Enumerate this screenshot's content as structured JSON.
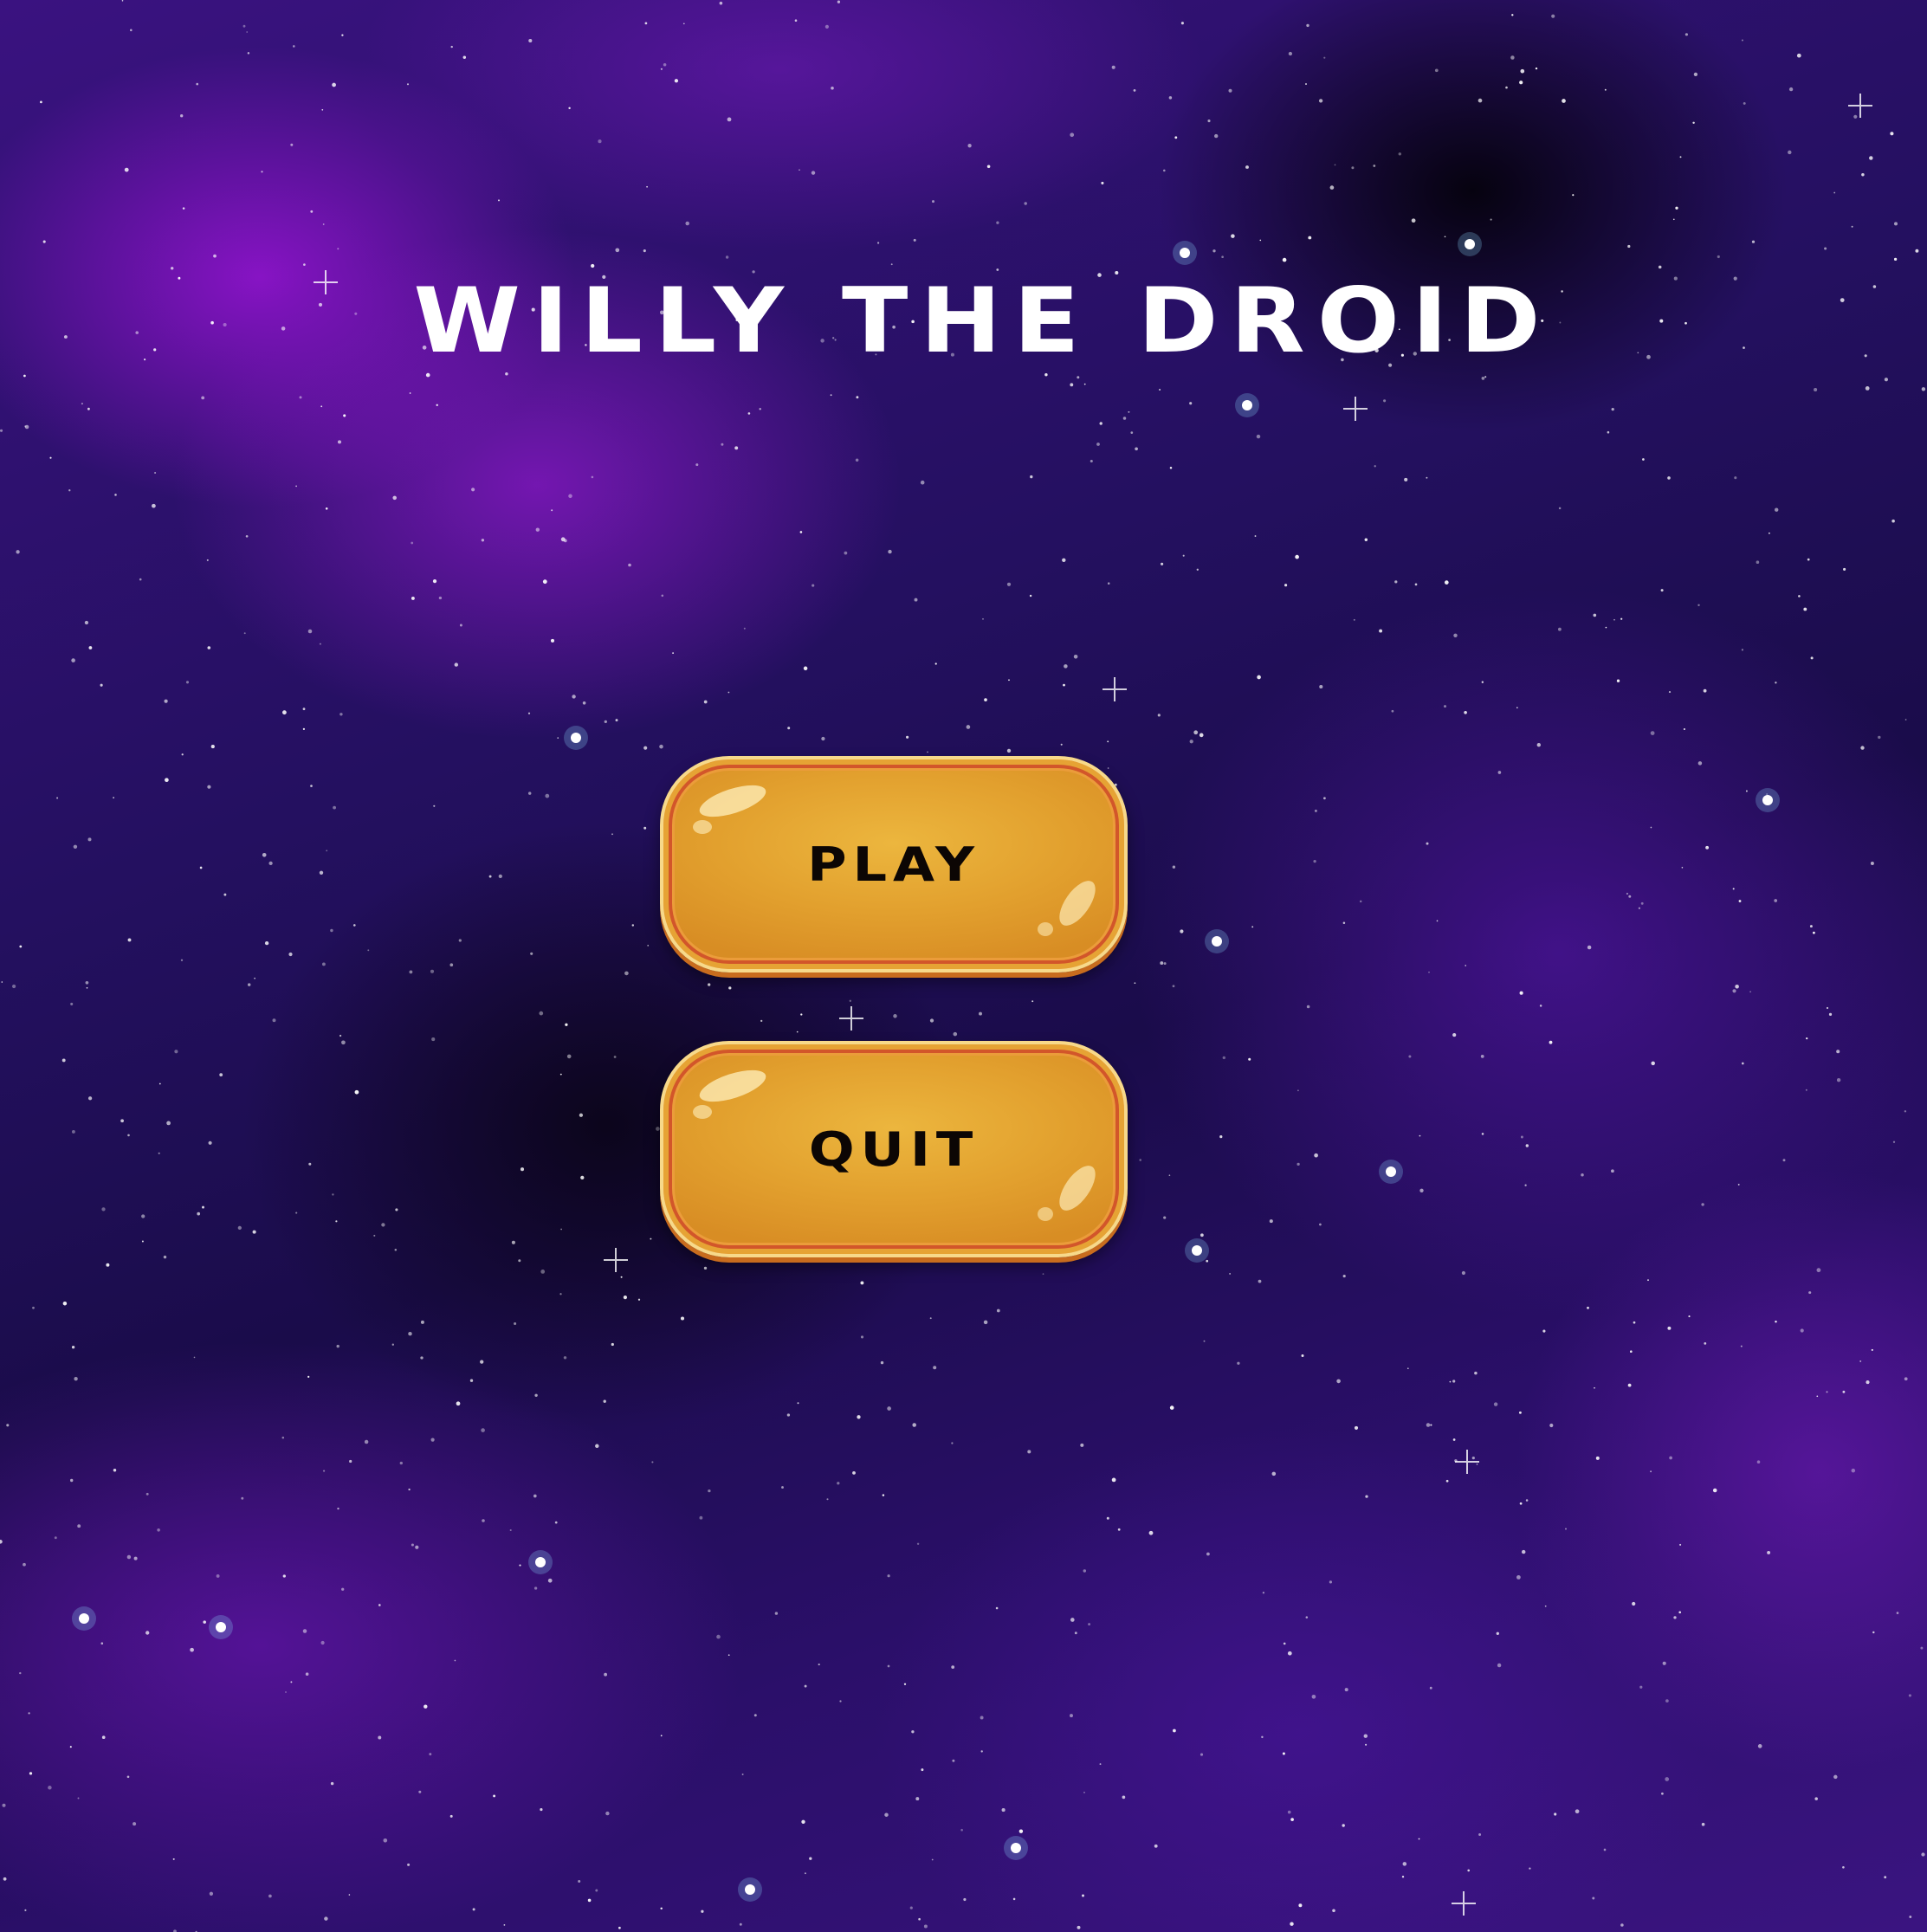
{
  "title": "WILLY THE DROID",
  "menu": {
    "play_label": "PLAY",
    "quit_label": "QUIT"
  },
  "colors": {
    "title_text": "#ffffff",
    "button_fill": "#e2a02e",
    "button_border": "#d2562a",
    "button_text": "#0c0604",
    "background_nebula": "#3a1280"
  },
  "background": "starfield-nebula"
}
